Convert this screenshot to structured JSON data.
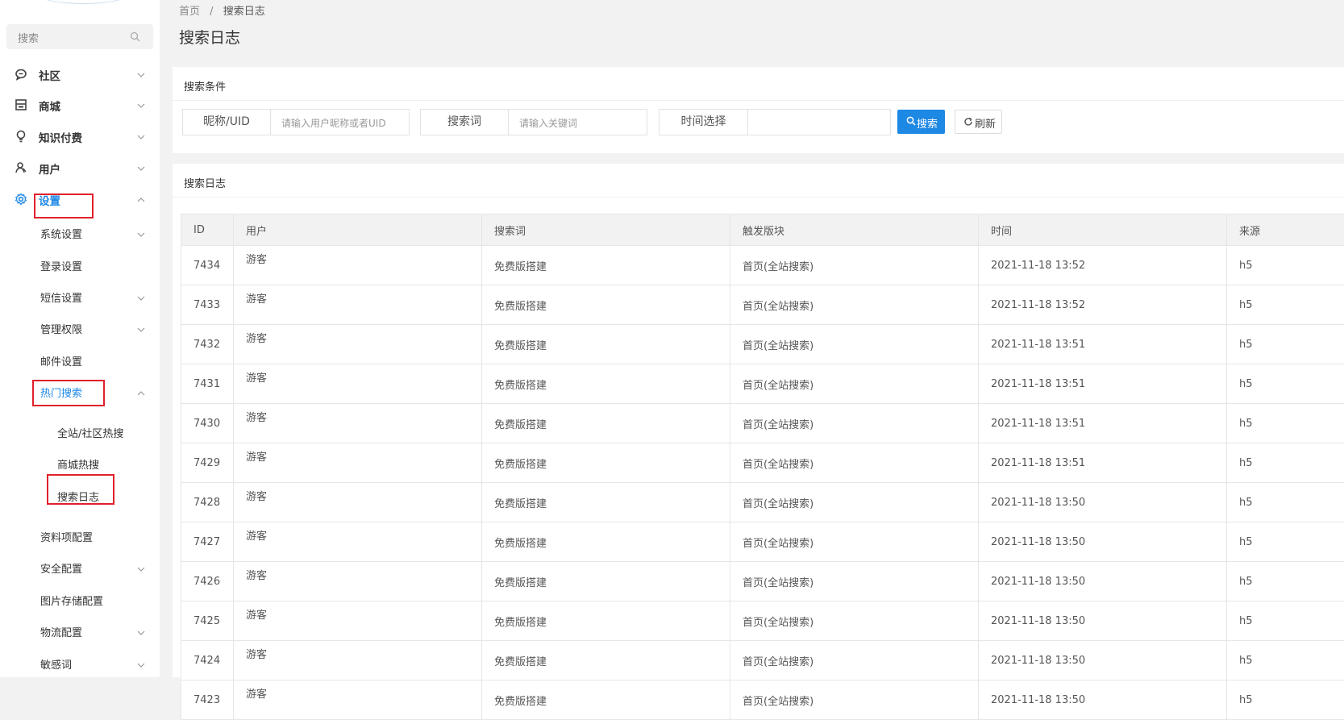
{
  "sidebar": {
    "search_placeholder": "搜索",
    "menu": [
      {
        "label": "社区",
        "icon": "chat-icon"
      },
      {
        "label": "商城",
        "icon": "store-icon"
      },
      {
        "label": "知识付费",
        "icon": "lightbulb-icon"
      },
      {
        "label": "用户",
        "icon": "user-icon"
      },
      {
        "label": "设置",
        "icon": "gear-icon"
      }
    ],
    "settings_sub": [
      {
        "label": "系统设置"
      },
      {
        "label": "登录设置"
      },
      {
        "label": "短信设置"
      },
      {
        "label": "管理权限"
      },
      {
        "label": "邮件设置"
      },
      {
        "label": "热门搜索"
      },
      {
        "label": "资料项配置"
      },
      {
        "label": "安全配置"
      },
      {
        "label": "图片存储配置"
      },
      {
        "label": "物流配置"
      },
      {
        "label": "敏感词"
      }
    ],
    "hot_search_sub": [
      {
        "label": "全站/社区热搜"
      },
      {
        "label": "商城热搜"
      },
      {
        "label": "搜索日志"
      }
    ]
  },
  "breadcrumb": {
    "home": "首页",
    "separator": "/",
    "current": "搜索日志"
  },
  "page_title": "搜索日志",
  "filter": {
    "title": "搜索条件",
    "nickname_label": "昵称/UID",
    "nickname_placeholder": "请输入用户昵称或者UID",
    "keyword_label": "搜索词",
    "keyword_placeholder": "请输入关键词",
    "time_label": "时间选择",
    "search_button": "搜索",
    "refresh_button": "刷新"
  },
  "log": {
    "title": "搜索日志",
    "columns": [
      "ID",
      "用户",
      "搜索词",
      "触发版块",
      "时间",
      "来源"
    ],
    "rows": [
      [
        "7434",
        "游客",
        "免费版搭建",
        "首页(全站搜索)",
        "2021-11-18 13:52",
        "h5"
      ],
      [
        "7433",
        "游客",
        "免费版搭建",
        "首页(全站搜索)",
        "2021-11-18 13:52",
        "h5"
      ],
      [
        "7432",
        "游客",
        "免费版搭建",
        "首页(全站搜索)",
        "2021-11-18 13:51",
        "h5"
      ],
      [
        "7431",
        "游客",
        "免费版搭建",
        "首页(全站搜索)",
        "2021-11-18 13:51",
        "h5"
      ],
      [
        "7430",
        "游客",
        "免费版搭建",
        "首页(全站搜索)",
        "2021-11-18 13:51",
        "h5"
      ],
      [
        "7429",
        "游客",
        "免费版搭建",
        "首页(全站搜索)",
        "2021-11-18 13:51",
        "h5"
      ],
      [
        "7428",
        "游客",
        "免费版搭建",
        "首页(全站搜索)",
        "2021-11-18 13:50",
        "h5"
      ],
      [
        "7427",
        "游客",
        "免费版搭建",
        "首页(全站搜索)",
        "2021-11-18 13:50",
        "h5"
      ],
      [
        "7426",
        "游客",
        "免费版搭建",
        "首页(全站搜索)",
        "2021-11-18 13:50",
        "h5"
      ],
      [
        "7425",
        "游客",
        "免费版搭建",
        "首页(全站搜索)",
        "2021-11-18 13:50",
        "h5"
      ],
      [
        "7424",
        "游客",
        "免费版搭建",
        "首页(全站搜索)",
        "2021-11-18 13:50",
        "h5"
      ],
      [
        "7423",
        "游客",
        "免费版搭建",
        "首页(全站搜索)",
        "2021-11-18 13:50",
        "h5"
      ]
    ]
  },
  "colors": {
    "accent": "#1e88e5",
    "highlight_box": "#e0202a"
  }
}
